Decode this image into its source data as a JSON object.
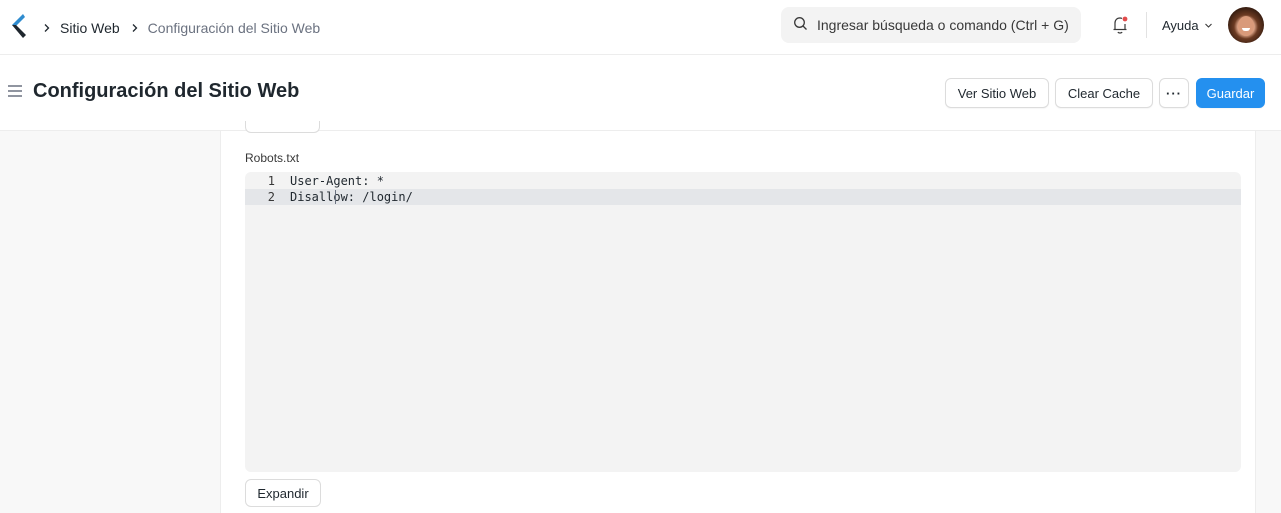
{
  "navbar": {
    "logo": "app-logo-chevron",
    "breadcrumbs": [
      {
        "label": "Sitio Web"
      },
      {
        "label": "Configuración del Sitio Web"
      }
    ],
    "search_placeholder": "Ingresar búsqueda o comando (Ctrl + G)",
    "notifications_icon": "bell-icon",
    "has_unread_notifications": true,
    "help_label": "Ayuda",
    "avatar": "user-avatar"
  },
  "page": {
    "title": "Configuración del Sitio Web",
    "actions": {
      "view_site": "Ver Sitio Web",
      "clear_cache": "Clear Cache",
      "more": "···",
      "save": "Guardar"
    }
  },
  "form": {
    "robots_label": "Robots.txt",
    "robots_lines": [
      {
        "number": "1",
        "text": "User-Agent: *"
      },
      {
        "number": "2",
        "text": "Disallow: /login/"
      }
    ],
    "active_line": 2,
    "expand_label": "Expandir"
  },
  "colors": {
    "primary": "#2490ef",
    "notification_dot": "#e24c4c",
    "logo_blue": "#2f8ccf",
    "logo_dark": "#1f272e"
  }
}
